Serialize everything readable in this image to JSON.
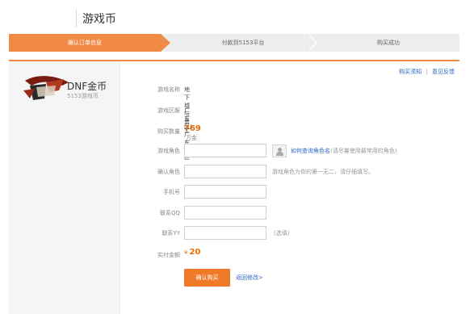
{
  "header": {
    "title": "游戏币"
  },
  "steps": [
    {
      "label": "确认订单信息",
      "active": true
    },
    {
      "label": "付款到5153平台",
      "active": false
    },
    {
      "label": "购买成功",
      "active": false
    }
  ],
  "product": {
    "name": "DNF金币",
    "subtitle": "5153游戏币"
  },
  "toplinks": {
    "guide": "购买须知",
    "feedback": "意见反馈",
    "separator": "|"
  },
  "form": {
    "game_name": {
      "label": "游戏名称",
      "value": "地下城与勇士"
    },
    "server": {
      "label": "游戏区服",
      "value": "广东区/广东1区"
    },
    "quantity": {
      "label": "购买数量",
      "value": "769",
      "unit": "万金币"
    },
    "character": {
      "label": "游戏角色",
      "link": "如何查询角色名",
      "hint": "(请尽量使用最常用的角色)"
    },
    "confirm_character": {
      "label": "确认角色",
      "hint": "游戏角色为你的第一无二，请仔细填写。"
    },
    "phone": {
      "label": "手机号"
    },
    "qq": {
      "label": "联系QQ"
    },
    "yy": {
      "label": "联系YY",
      "hint": "(选填)"
    },
    "amount": {
      "label": "实付金额",
      "currency": "¥",
      "value": "20"
    }
  },
  "actions": {
    "confirm": "确认购买",
    "back": "返回修改>"
  },
  "colors": {
    "accent": "#f08a45",
    "link": "#2a66c5",
    "price": "#ee6a00"
  }
}
